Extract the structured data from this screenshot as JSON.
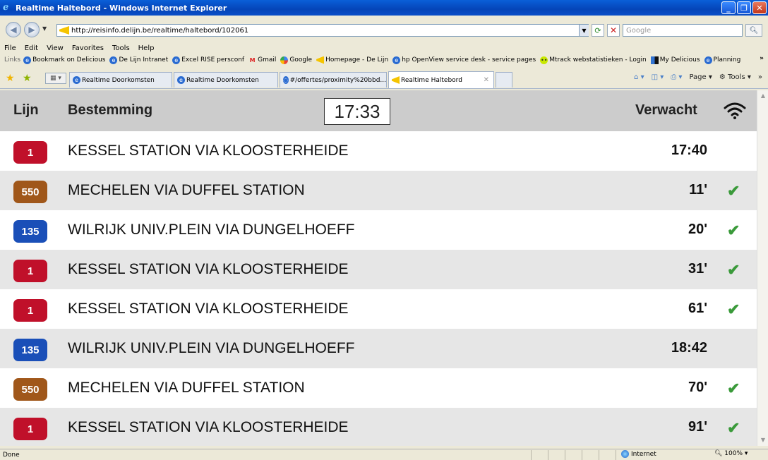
{
  "window": {
    "title": "Realtime Haltebord - Windows Internet Explorer",
    "minimize": "_",
    "maximize": "❐",
    "close": "✕"
  },
  "address": {
    "url": "http://reisinfo.delijn.be/realtime/haltebord/102061",
    "search_placeholder": "Google"
  },
  "menu": [
    "File",
    "Edit",
    "View",
    "Favorites",
    "Tools",
    "Help"
  ],
  "links": {
    "label": "Links",
    "items": [
      {
        "label": "Bookmark on Delicious",
        "icon": "ie"
      },
      {
        "label": "De Lijn Intranet",
        "icon": "ie"
      },
      {
        "label": "Excel RISE persconf",
        "icon": "ie"
      },
      {
        "label": "Gmail",
        "icon": "gmail"
      },
      {
        "label": "Google",
        "icon": "google"
      },
      {
        "label": "Homepage - De Lijn",
        "icon": "lijn"
      },
      {
        "label": "hp OpenView service desk - service pages",
        "icon": "ie"
      },
      {
        "label": "Mtrack webstatistieken - Login",
        "icon": "mtrack"
      },
      {
        "label": "My Delicious",
        "icon": "delicious"
      },
      {
        "label": "Planning",
        "icon": "ie"
      }
    ]
  },
  "tabs": [
    {
      "label": "Realtime Doorkomsten",
      "active": false
    },
    {
      "label": "Realtime Doorkomsten",
      "active": false
    },
    {
      "label": "#/offertes/proximity%20bbd...",
      "active": false
    },
    {
      "label": "Realtime Haltebord",
      "active": true
    }
  ],
  "command_bar": {
    "page": "Page",
    "tools": "Tools"
  },
  "board": {
    "header": {
      "lijn": "Lijn",
      "bestemming": "Bestemming",
      "clock": "17:33",
      "verwacht": "Verwacht"
    },
    "colors": {
      "red": "#c0102a",
      "brown": "#a0571a",
      "blue": "#1a4fb8",
      "check": "#3a9a3a"
    },
    "rows": [
      {
        "line": "1",
        "color": "red",
        "destination": "KESSEL STATION VIA KLOOSTERHEIDE",
        "time": "17:40",
        "realtime": false
      },
      {
        "line": "550",
        "color": "brown",
        "destination": "MECHELEN VIA DUFFEL STATION",
        "time": "11'",
        "realtime": true
      },
      {
        "line": "135",
        "color": "blue",
        "destination": "WILRIJK UNIV.PLEIN VIA DUNGELHOEFF",
        "time": "20'",
        "realtime": true
      },
      {
        "line": "1",
        "color": "red",
        "destination": "KESSEL STATION VIA KLOOSTERHEIDE",
        "time": "31'",
        "realtime": true
      },
      {
        "line": "1",
        "color": "red",
        "destination": "KESSEL STATION VIA KLOOSTERHEIDE",
        "time": "61'",
        "realtime": true
      },
      {
        "line": "135",
        "color": "blue",
        "destination": "WILRIJK UNIV.PLEIN VIA DUNGELHOEFF",
        "time": "18:42",
        "realtime": false
      },
      {
        "line": "550",
        "color": "brown",
        "destination": "MECHELEN VIA DUFFEL STATION",
        "time": "70'",
        "realtime": true
      },
      {
        "line": "1",
        "color": "red",
        "destination": "KESSEL STATION VIA KLOOSTERHEIDE",
        "time": "91'",
        "realtime": true
      }
    ]
  },
  "status": {
    "text": "Done",
    "zone": "Internet",
    "zoom": "100%"
  }
}
